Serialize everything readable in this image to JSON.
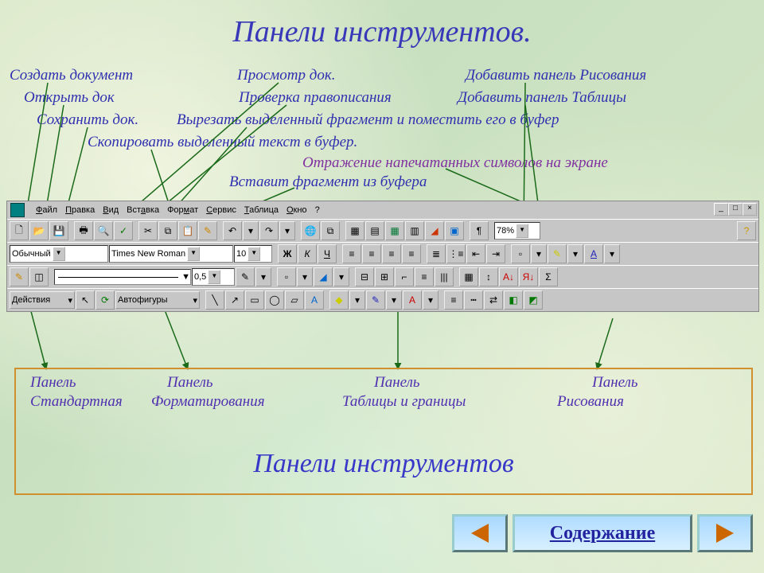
{
  "title": "Панели инструментов.",
  "annotations": {
    "create_doc": "Создать документ",
    "open_doc": "Открыть док",
    "save_doc": "Сохранить док.",
    "copy_buf": "Скопировать выделенный текст в буфер.",
    "preview": "Просмотр док.",
    "spellcheck": "Проверка правописания",
    "cut_buf": "Вырезать выделенный фрагмент и поместить его в буфер",
    "paste_buf": "Вставит фрагмент из буфера",
    "show_marks": "Отражение напечатанных символов на экране",
    "add_draw": "Добавить панель Рисования",
    "add_table": "Добавить панель Таблицы"
  },
  "menu": {
    "file": "Файл",
    "edit": "Правка",
    "view": "Вид",
    "insert": "Вставка",
    "format": "Формат",
    "tools": "Сервис",
    "table": "Таблица",
    "window": "Окно",
    "help": "?"
  },
  "format_bar": {
    "style": "Обычный",
    "font": "Times New Roman",
    "size": "10",
    "bold": "Ж",
    "italic": "К",
    "underline": "Ч"
  },
  "tables_bar": {
    "width": "0,5"
  },
  "draw_bar": {
    "actions": "Действия",
    "autoshapes": "Автофигуры"
  },
  "standard_bar": {
    "zoom": "78%",
    "pilcrow": "¶"
  },
  "caption": {
    "p1a": "Панель",
    "p1b": "Стандартная",
    "p2a": "Панель",
    "p2b": "Форматирования",
    "p3a": "Панель",
    "p3b": "Таблицы и границы",
    "p4a": "Панель",
    "p4b": "Рисования",
    "big": "Панели инструментов"
  },
  "nav": {
    "contents": "Содержание"
  }
}
